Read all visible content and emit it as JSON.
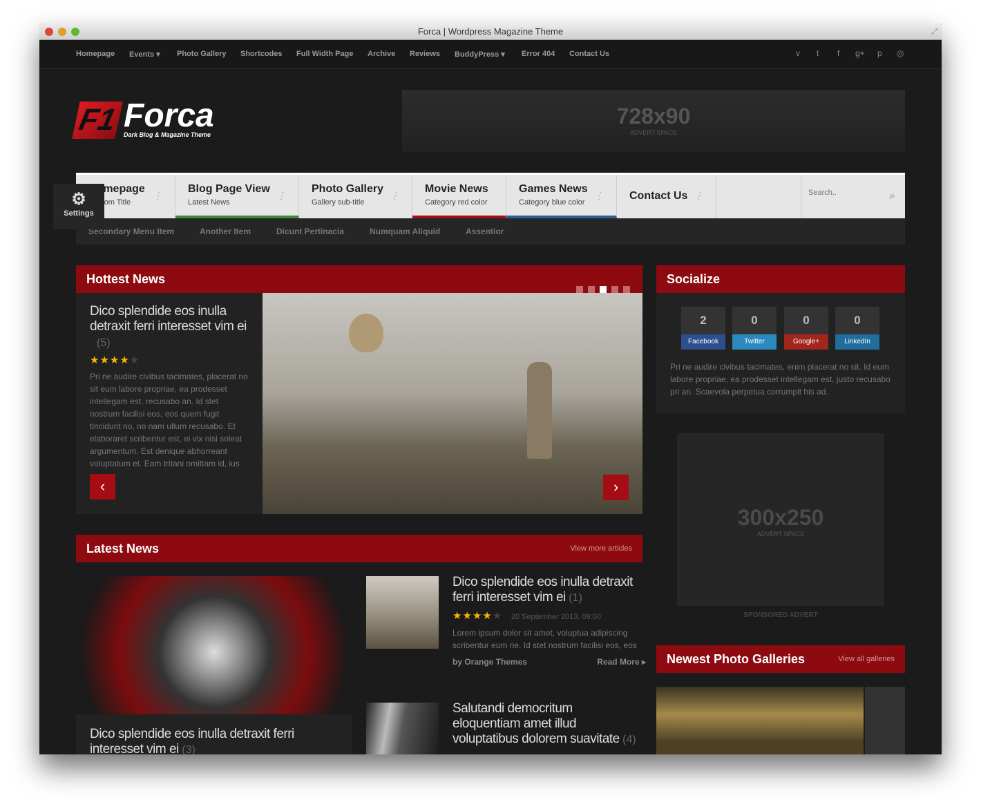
{
  "window": {
    "title": "Forca | Wordpress Magazine Theme"
  },
  "topnav": {
    "items": [
      {
        "label": "Homepage"
      },
      {
        "label": "Events ▾"
      },
      {
        "label": "Photo Gallery"
      },
      {
        "label": "Shortcodes"
      },
      {
        "label": "Full Width Page"
      },
      {
        "label": "Archive"
      },
      {
        "label": "Reviews"
      },
      {
        "label": "BuddyPress ▾"
      },
      {
        "label": "Error 404"
      },
      {
        "label": "Contact Us"
      }
    ],
    "social_icons": [
      "vimeo-icon",
      "twitter-icon",
      "facebook-icon",
      "google-plus-icon",
      "pinterest-icon",
      "dribbble-icon"
    ],
    "social_glyphs": [
      "v",
      "t",
      "f",
      "g+",
      "p",
      "◎"
    ]
  },
  "logo": {
    "mark": "F1",
    "name": "Forca",
    "tagline": "Dark Blog & Magazine Theme"
  },
  "header_advert": {
    "size": "728x90",
    "label": "ADVERT SPACE"
  },
  "main_menu": [
    {
      "title": "Homepage",
      "sub": "Custom Title"
    },
    {
      "title": "Blog Page View",
      "sub": "Latest News",
      "color": "#3f8a3a"
    },
    {
      "title": "Photo Gallery",
      "sub": "Gallery sub-title"
    },
    {
      "title": "Movie News",
      "sub": "Category red color",
      "color": "#a3111a"
    },
    {
      "title": "Games News",
      "sub": "Category blue color",
      "color": "#2a5f8f"
    },
    {
      "title": "Contact Us",
      "sub": ""
    }
  ],
  "search": {
    "placeholder": "Search.."
  },
  "secondary_menu": [
    "Secondary Menu Item",
    "Another Item",
    "Dicunt Pertinacia",
    "Numquam Aliquid",
    "Assentior"
  ],
  "settings": {
    "label": "Settings"
  },
  "hottest": {
    "title": "Hottest News",
    "slide_count": 5,
    "active_slide": 3,
    "headline": "Dico splendide eos inulla detraxit ferri interesset vim ei",
    "comments": "(5)",
    "rating": 4,
    "text": "Pri ne audire civibus tacimates, placerat no sit eum labore propriae, ea prodesset intellegam est, recusabo an. Id stet nostrum facilisi eos, eos quem fugit tincidunt no, no nam ullum recusabo. Et elaboraret scribentur est, ei vix nisi soleat argumentum. Est denique abhorreant voluptatum et. Eam tritani omittam id, ius"
  },
  "latest": {
    "title": "Latest News",
    "more": "View more articles",
    "feature": {
      "headline": "Dico splendide eos inulla detraxit ferri interesset vim ei",
      "comments": "(3)"
    },
    "items": [
      {
        "headline": "Dico splendide eos inulla detraxit ferri interesset vim ei",
        "comments": "(1)",
        "rating": 4,
        "date": "20 September 2013, 09:00",
        "text": "Lorem ipsum dolor sit amet, voluptua adipiscing scribentur eum ne. Id stet nostrum facilisi eos, eos",
        "author": "by Orange Themes",
        "read_more": "Read More ▸"
      },
      {
        "headline": "Salutandi democritum eloquentiam amet illud voluptatibus dolorem suavitate",
        "comments": "(4)"
      }
    ]
  },
  "socialize": {
    "title": "Socialize",
    "counters": [
      {
        "count": "2",
        "label": "Facebook",
        "color": "#2e4f8f"
      },
      {
        "count": "0",
        "label": "Twitter",
        "color": "#2a8ac0"
      },
      {
        "count": "0",
        "label": "Google+",
        "color": "#a3261d"
      },
      {
        "count": "0",
        "label": "LinkedIn",
        "color": "#1f6e9c"
      }
    ],
    "text": "Pri ne audire civibus tacimates, enim placerat no sit. Id eum labore propriae, ea prodesset intellegam est, justo recusabo pri an. Scaevola perpetua corrumpit his ad."
  },
  "side_advert": {
    "size": "300x250",
    "label": "ADVERT SPACE",
    "sponsored": "SPONSORED ADVERT"
  },
  "galleries": {
    "title": "Newest Photo Galleries",
    "more": "View all galleries"
  }
}
